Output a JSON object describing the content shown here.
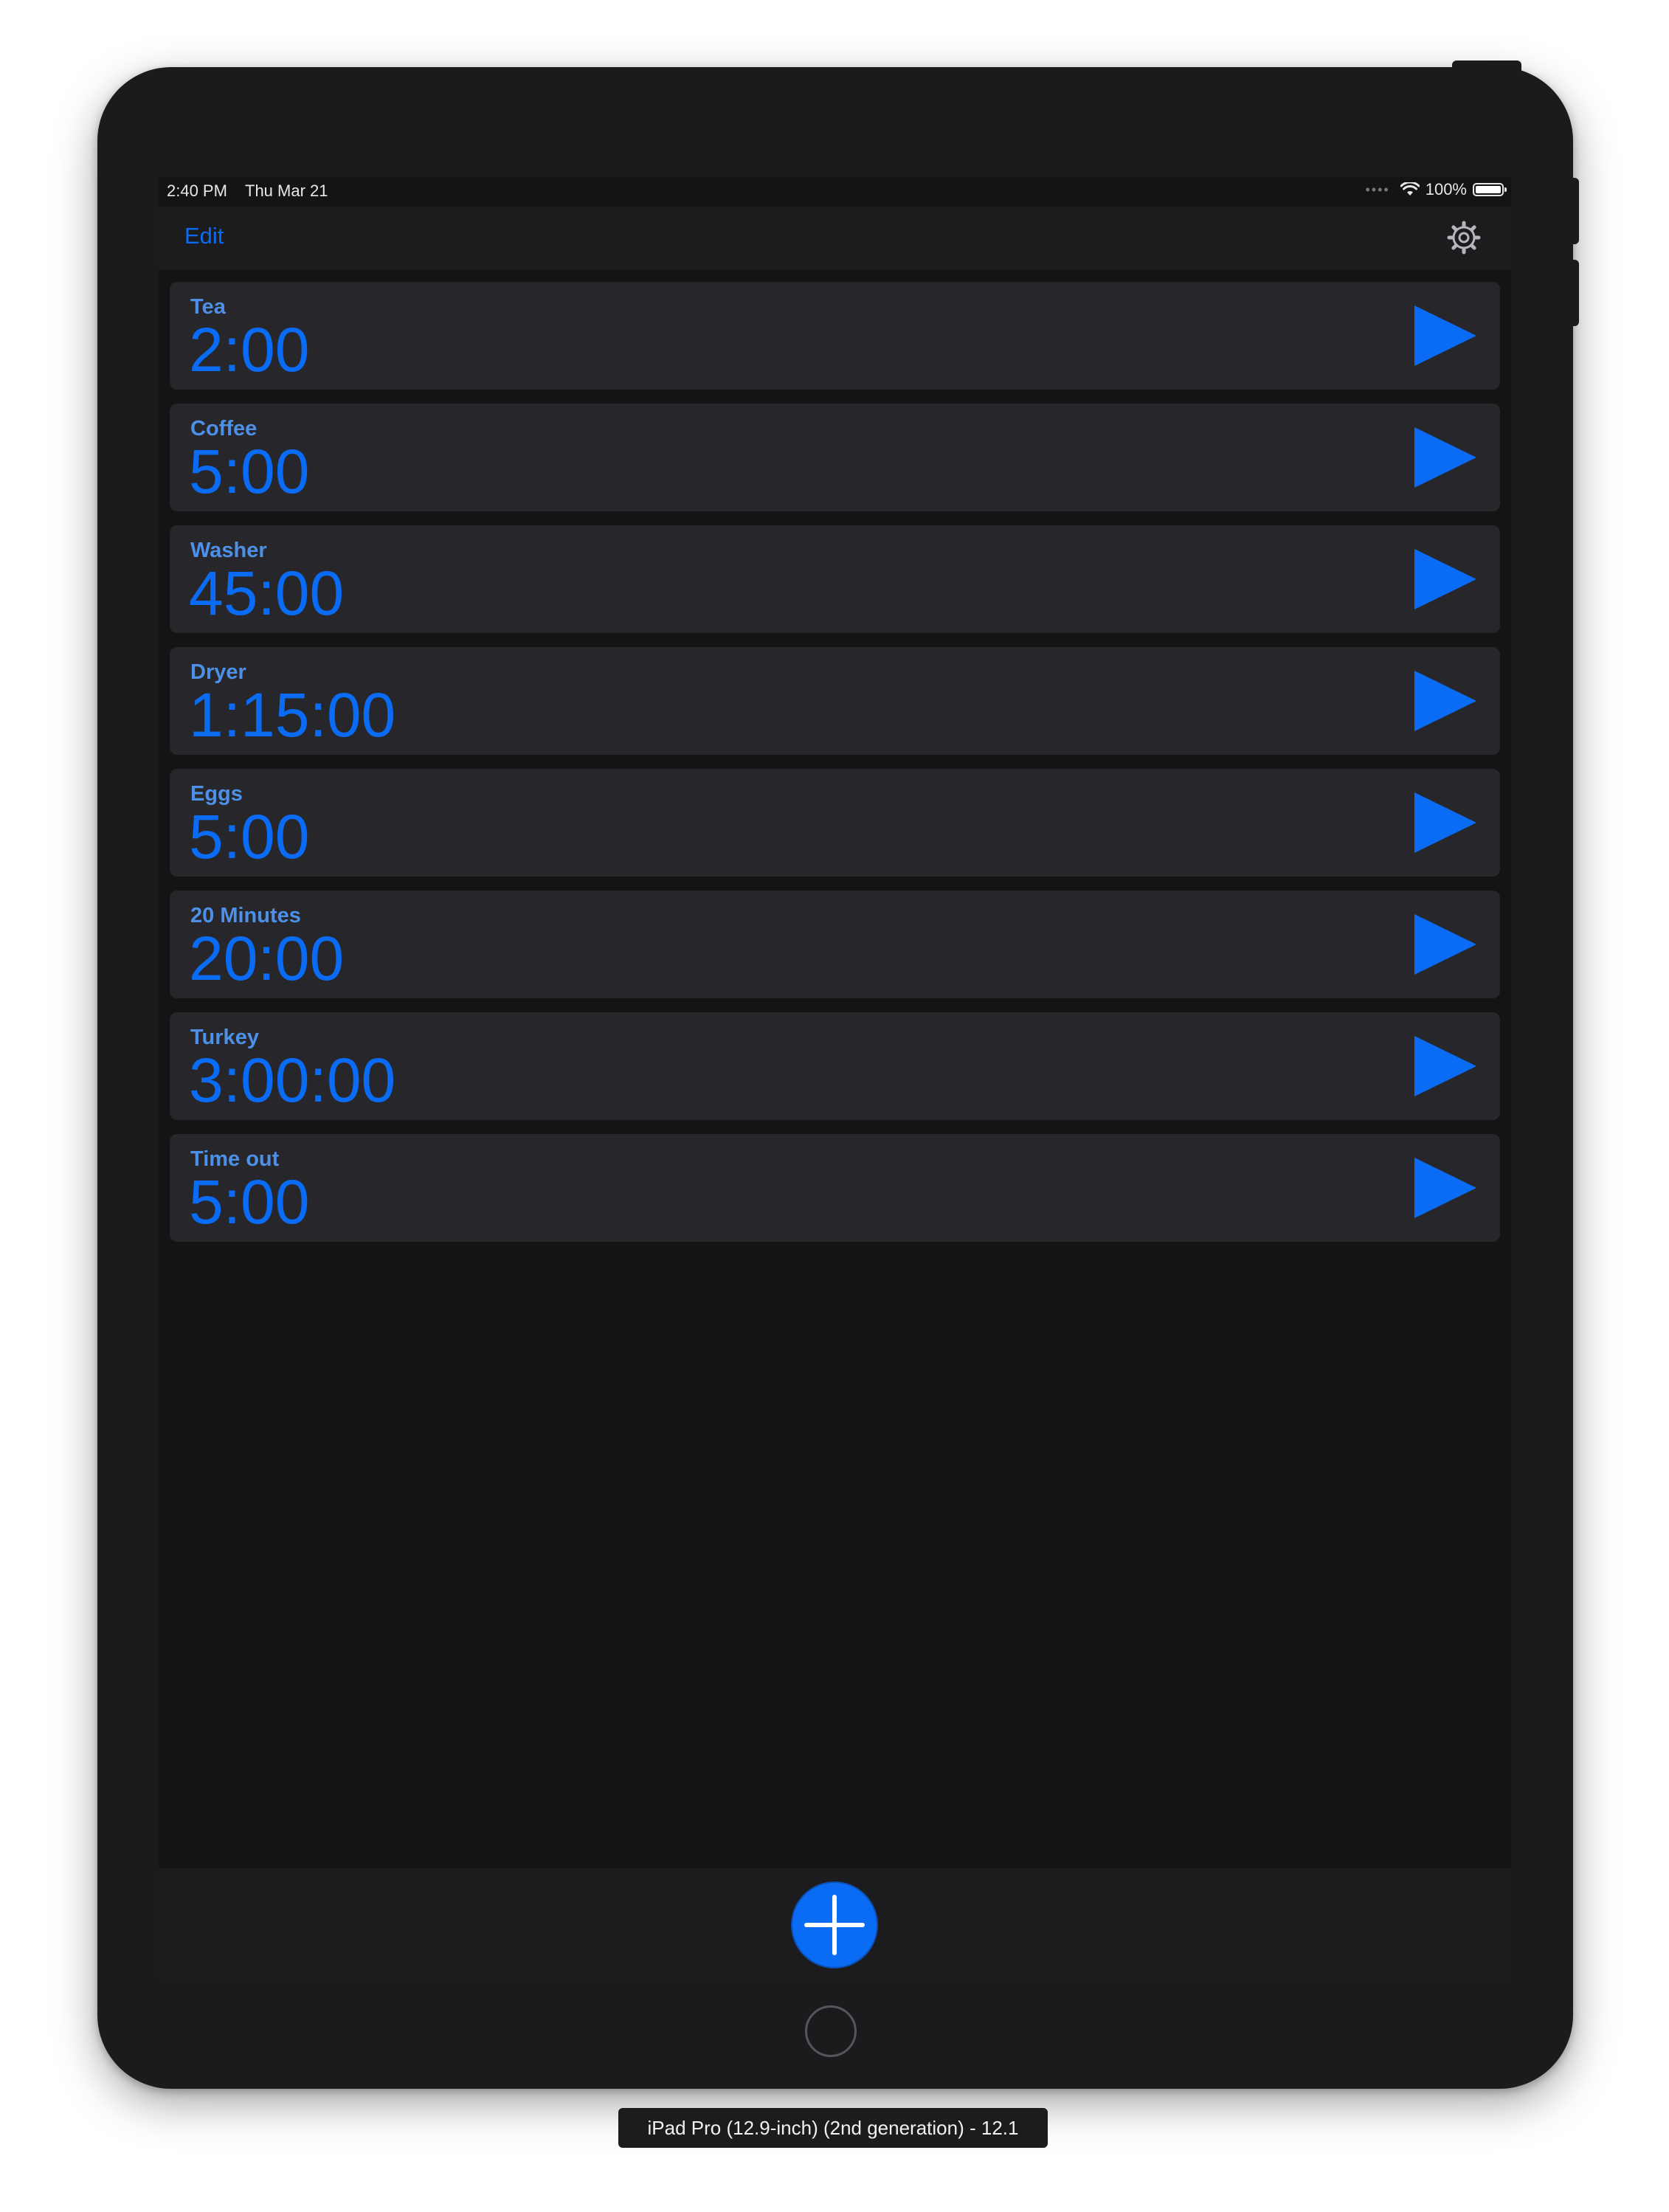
{
  "status_bar": {
    "time": "2:40 PM",
    "date": "Thu Mar 21",
    "battery": "100%"
  },
  "nav": {
    "edit_label": "Edit"
  },
  "timers": [
    {
      "name": "Tea",
      "duration": "2:00"
    },
    {
      "name": "Coffee",
      "duration": "5:00"
    },
    {
      "name": "Washer",
      "duration": "45:00"
    },
    {
      "name": "Dryer",
      "duration": "1:15:00"
    },
    {
      "name": "Eggs",
      "duration": "5:00"
    },
    {
      "name": "20 Minutes",
      "duration": "20:00"
    },
    {
      "name": "Turkey",
      "duration": "3:00:00"
    },
    {
      "name": "Time out",
      "duration": "5:00"
    }
  ],
  "simulator": {
    "label": "iPad Pro (12.9-inch) (2nd generation) - 12.1"
  },
  "colors": {
    "accent": "#0a6cf5",
    "label_blue": "#4d90e8",
    "row_bg": "#27272b",
    "screen_bg": "#141415"
  },
  "icons": {
    "settings": "gear-icon",
    "start": "play-icon",
    "add": "plus-icon"
  }
}
